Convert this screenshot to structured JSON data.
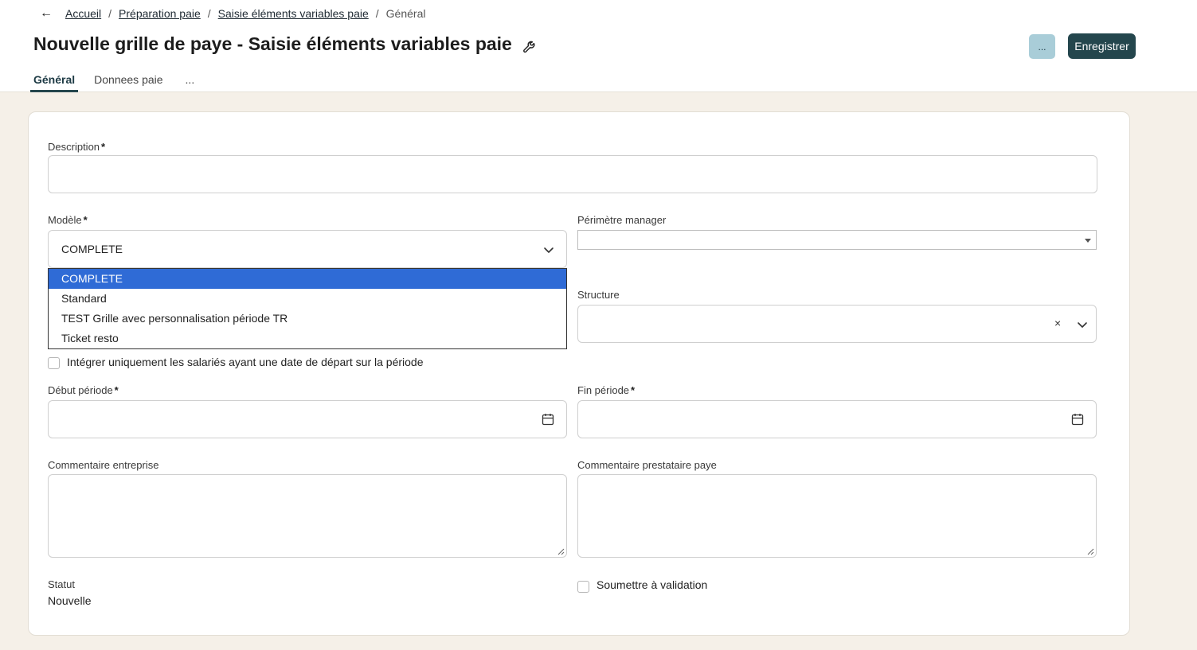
{
  "breadcrumb": {
    "items": [
      "Accueil",
      "Préparation paie",
      "Saisie éléments variables paie"
    ],
    "current": "Général",
    "separator": "/"
  },
  "page": {
    "title": "Nouvelle grille de paye - Saisie éléments variables paie"
  },
  "actions": {
    "more_label": "...",
    "save_label": "Enregistrer"
  },
  "tabs": [
    {
      "label": "Général",
      "active": true
    },
    {
      "label": "Donnees paie",
      "active": false
    },
    {
      "label": "...",
      "active": false
    }
  ],
  "form": {
    "description": {
      "label": "Description",
      "required_mark": "*",
      "value": ""
    },
    "modele": {
      "label": "Modèle",
      "required_mark": "*",
      "selected": "COMPLETE",
      "options": [
        "COMPLETE",
        "Standard",
        "TEST Grille avec personnalisation période TR",
        "Ticket resto"
      ]
    },
    "perimetre_manager": {
      "label": "Périmètre manager",
      "value": ""
    },
    "structure": {
      "label": "Structure",
      "value": "",
      "clear_symbol": "×"
    },
    "integrer_checkbox": {
      "label": "Intégrer uniquement les salariés ayant une date de départ sur la période",
      "checked": false
    },
    "debut_periode": {
      "label": "Début période",
      "required_mark": "*",
      "value": ""
    },
    "fin_periode": {
      "label": "Fin période",
      "required_mark": "*",
      "value": ""
    },
    "commentaire_entreprise": {
      "label": "Commentaire entreprise",
      "value": ""
    },
    "commentaire_prestataire": {
      "label": "Commentaire prestataire paye",
      "value": ""
    },
    "statut": {
      "label": "Statut",
      "value": "Nouvelle"
    },
    "soumettre": {
      "label": "Soumettre à validation",
      "checked": false
    }
  },
  "colors": {
    "accent": "#24464d",
    "secondary_button": "#a9cdd8",
    "selected_option": "#2f6bd6",
    "background": "#f5f0e8"
  },
  "icons": {
    "back": "arrow-left-icon",
    "title": "wrench-icon",
    "select": "chevron-down-icon",
    "date": "calendar-icon"
  }
}
